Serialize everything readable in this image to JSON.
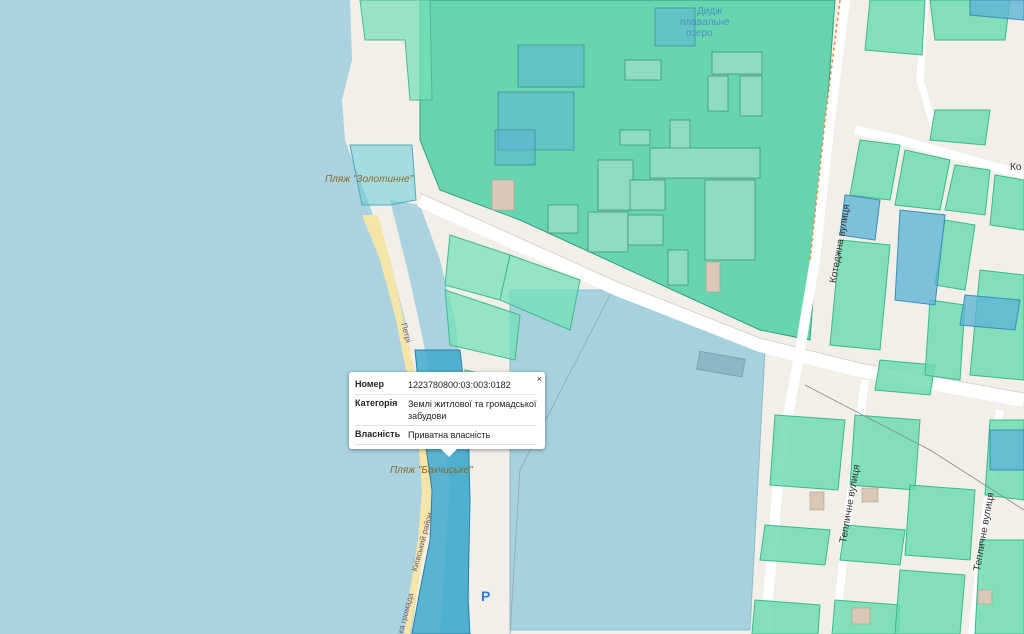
{
  "colors": {
    "water": "#aad3df",
    "land": "#f2efe9",
    "parcel": "#6fdcb0",
    "parcel_dark": "#3fc6a0",
    "parcel_blue": "#5fb4d6",
    "highlight": "#3fa8cc",
    "road": "#ffffff",
    "sand": "#f5e5a8"
  },
  "labels": {
    "beach1": "Пляж \"Золотинне\"",
    "beach2": "Пляж \"Бахчиське\"",
    "street1": "Котеджна вулиця",
    "street2": "Тепличне вулиця",
    "street3": "Тепличне вулиця",
    "street4": "Ко",
    "water1": "Дидж",
    "water2": "плавальне",
    "water3": "озеро",
    "road1": "Петрі",
    "road2": "Київський район",
    "road3": "ка громада",
    "parking": "P"
  },
  "popup": {
    "close": "×",
    "rows": [
      {
        "key": "Номер",
        "value": "1223780800:03:003:0182"
      },
      {
        "key": "Категорія",
        "value": "Землі житлової та громадської забудови"
      },
      {
        "key": "Власність",
        "value": "Приватна власність"
      }
    ]
  }
}
